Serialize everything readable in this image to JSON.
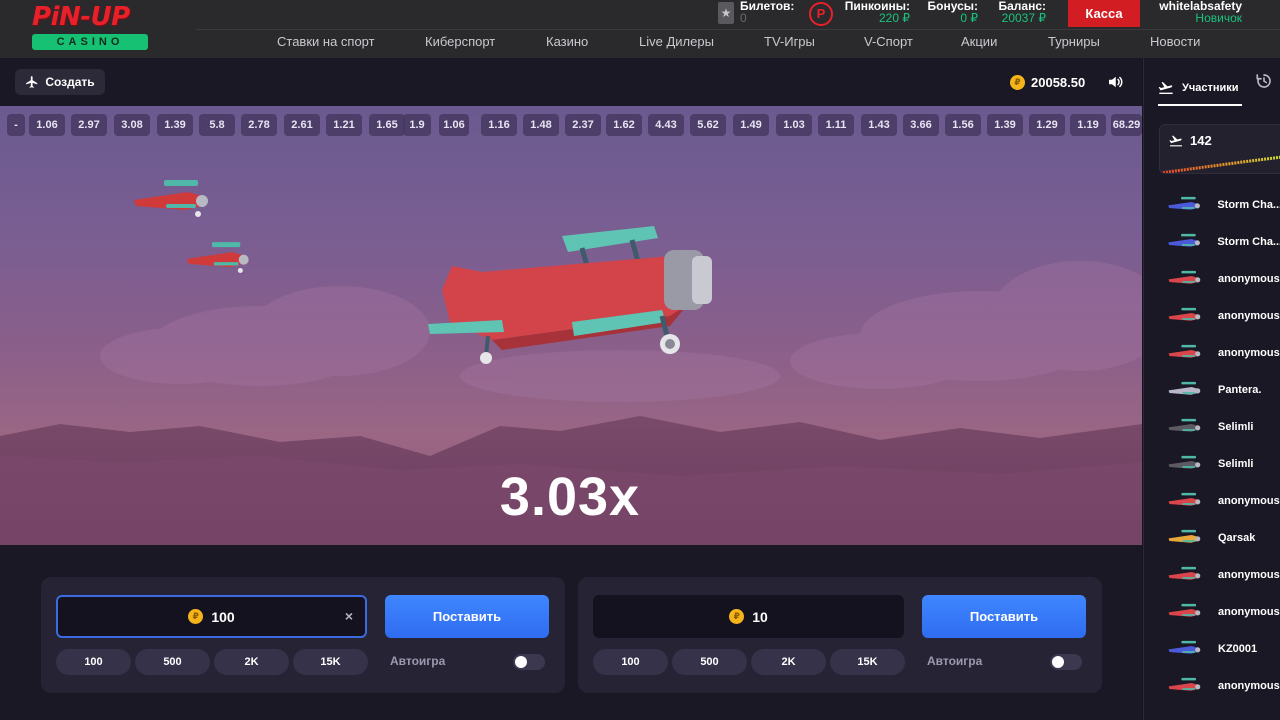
{
  "header": {
    "logo": {
      "main": "PiN-UP",
      "sub": "CASINO"
    },
    "tickets": {
      "label": "Билетов:",
      "value": "0"
    },
    "pincoins": {
      "label": "Пинкоины:",
      "value": "220 ₽"
    },
    "bonuses": {
      "label": "Бонусы:",
      "value": "0 ₽"
    },
    "balance": {
      "label": "Баланс:",
      "value": "20037 ₽"
    },
    "cashier_label": "Касса",
    "user": {
      "name": "whitelabsafety",
      "rank": "Новичок"
    },
    "nav": [
      "Ставки на спорт",
      "Киберспорт",
      "Казино",
      "Live Дилеры",
      "TV-Игры",
      "V-Спорт",
      "Акции",
      "Турниры",
      "Новости"
    ]
  },
  "game": {
    "create_label": "Создать",
    "balance": "20058.50",
    "coin_symbol": "₽",
    "history": [
      "-",
      "1.06",
      "2.97",
      "3.08",
      "1.39",
      "5.8",
      "2.78",
      "2.61",
      "1.21",
      "1.65",
      "1.9",
      "1.06",
      "1.16",
      "1.48",
      "2.37",
      "1.62",
      "4.43",
      "5.62",
      "1.49",
      "1.03",
      "1.11",
      "1.43",
      "3.66",
      "1.56",
      "1.39",
      "1.29",
      "1.19",
      "68.29"
    ],
    "multiplier": "3.03x"
  },
  "bets": [
    {
      "amount": "100",
      "bet_label": "Поставить",
      "quick": [
        "100",
        "500",
        "2K",
        "15K"
      ],
      "auto_label": "Автоигра",
      "clear": "×"
    },
    {
      "amount": "10",
      "bet_label": "Поставить",
      "quick": [
        "100",
        "500",
        "2K",
        "15K"
      ],
      "auto_label": "Автоигра"
    }
  ],
  "sidebar": {
    "tab_label": "Участники",
    "count": "142",
    "players": [
      {
        "name": "Storm Cha...",
        "plane_color": "#4a5ad8"
      },
      {
        "name": "Storm Cha...",
        "plane_color": "#4a5ad8"
      },
      {
        "name": "anonymous",
        "plane_color": "#d8454a"
      },
      {
        "name": "anonymous",
        "plane_color": "#d8454a"
      },
      {
        "name": "anonymous",
        "plane_color": "#d8454a"
      },
      {
        "name": "Pantera.",
        "plane_color": "#b8b6c8"
      },
      {
        "name": "Selimli",
        "plane_color": "#5c5a62"
      },
      {
        "name": "Selimli",
        "plane_color": "#5c5a62"
      },
      {
        "name": "anonymous",
        "plane_color": "#d8454a"
      },
      {
        "name": "Qarsak",
        "plane_color": "#e8a83a"
      },
      {
        "name": "anonymous",
        "plane_color": "#d8454a"
      },
      {
        "name": "anonymous",
        "plane_color": "#d8454a"
      },
      {
        "name": "KZ0001",
        "plane_color": "#4a5ad8"
      },
      {
        "name": "anonymous",
        "plane_color": "#d8454a"
      }
    ]
  },
  "colors": {
    "brand_red": "#e8202a",
    "brand_green": "#19c37d",
    "bet_blue": "#3f86ff",
    "coin_gold": "#f4b41a"
  }
}
